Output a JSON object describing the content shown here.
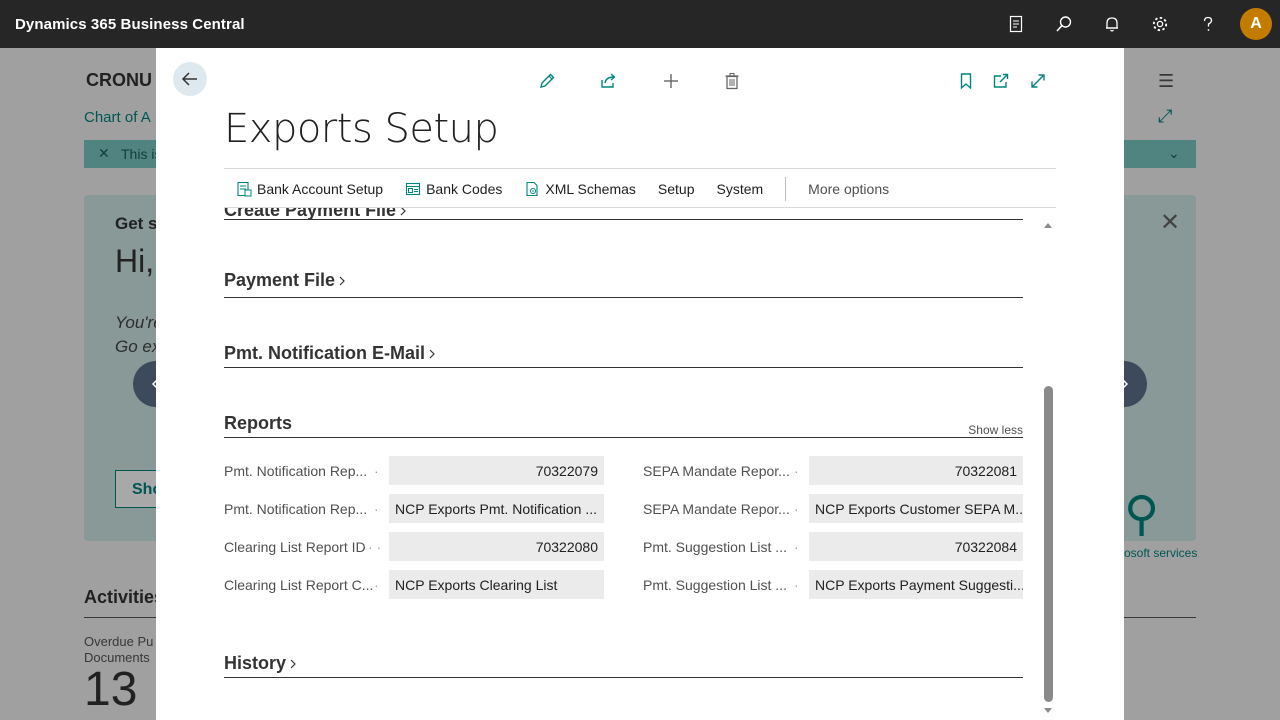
{
  "app": {
    "title": "Dynamics 365 Business Central",
    "avatar_initial": "A",
    "top_icons": [
      "document-icon",
      "search-icon",
      "bell-icon",
      "gear-icon",
      "help-icon"
    ]
  },
  "background": {
    "company": "CRONU",
    "breadcrumb": "Chart of A",
    "banner_text": "This is",
    "card_get": "Get s",
    "card_hi": "Hi,",
    "card_line1": "You're",
    "card_line2": "Go ex",
    "card_button": "Sho",
    "ms_services": "osoft services",
    "activities": "Activities",
    "overdue_line1": "Overdue Pu",
    "overdue_line2": "Documents",
    "overdue_value": "13"
  },
  "dialog": {
    "title": "Exports Setup",
    "actions": [
      {
        "label": "Bank Account Setup",
        "icon": "bank-account-icon"
      },
      {
        "label": "Bank Codes",
        "icon": "bank-codes-icon"
      },
      {
        "label": "XML Schemas",
        "icon": "xml-schema-icon"
      },
      {
        "label": "Setup",
        "icon": ""
      },
      {
        "label": "System",
        "icon": ""
      }
    ],
    "more_options": "More options",
    "sections": {
      "create_payment_file": "Create Payment File",
      "payment_file": "Payment File",
      "pmt_notification_email": "Pmt. Notification E-Mail",
      "reports": "Reports",
      "show_less": "Show less",
      "history": "History"
    },
    "report_fields": {
      "left": [
        {
          "label": "Pmt. Notification Rep...",
          "value": "70322079",
          "numeric": true
        },
        {
          "label": "Pmt. Notification Rep...",
          "value": "NCP Exports Pmt. Notification ...",
          "numeric": false
        },
        {
          "label": "Clearing List Report ID",
          "value": "70322080",
          "numeric": true
        },
        {
          "label": "Clearing List Report C...",
          "value": "NCP Exports Clearing List",
          "numeric": false
        }
      ],
      "right": [
        {
          "label": "SEPA Mandate Repor...",
          "value": "70322081",
          "numeric": true
        },
        {
          "label": "SEPA Mandate Repor...",
          "value": "NCP Exports Customer SEPA M...",
          "numeric": false
        },
        {
          "label": "Pmt. Suggestion List ...",
          "value": "70322084",
          "numeric": true
        },
        {
          "label": "Pmt. Suggestion List ...",
          "value": "NCP Exports Payment Suggesti...",
          "numeric": false
        }
      ]
    }
  },
  "colors": {
    "appbar": "#262626",
    "accent": "#00857d",
    "avatar": "#c47c00",
    "nav_button": "#3c4a5c"
  }
}
